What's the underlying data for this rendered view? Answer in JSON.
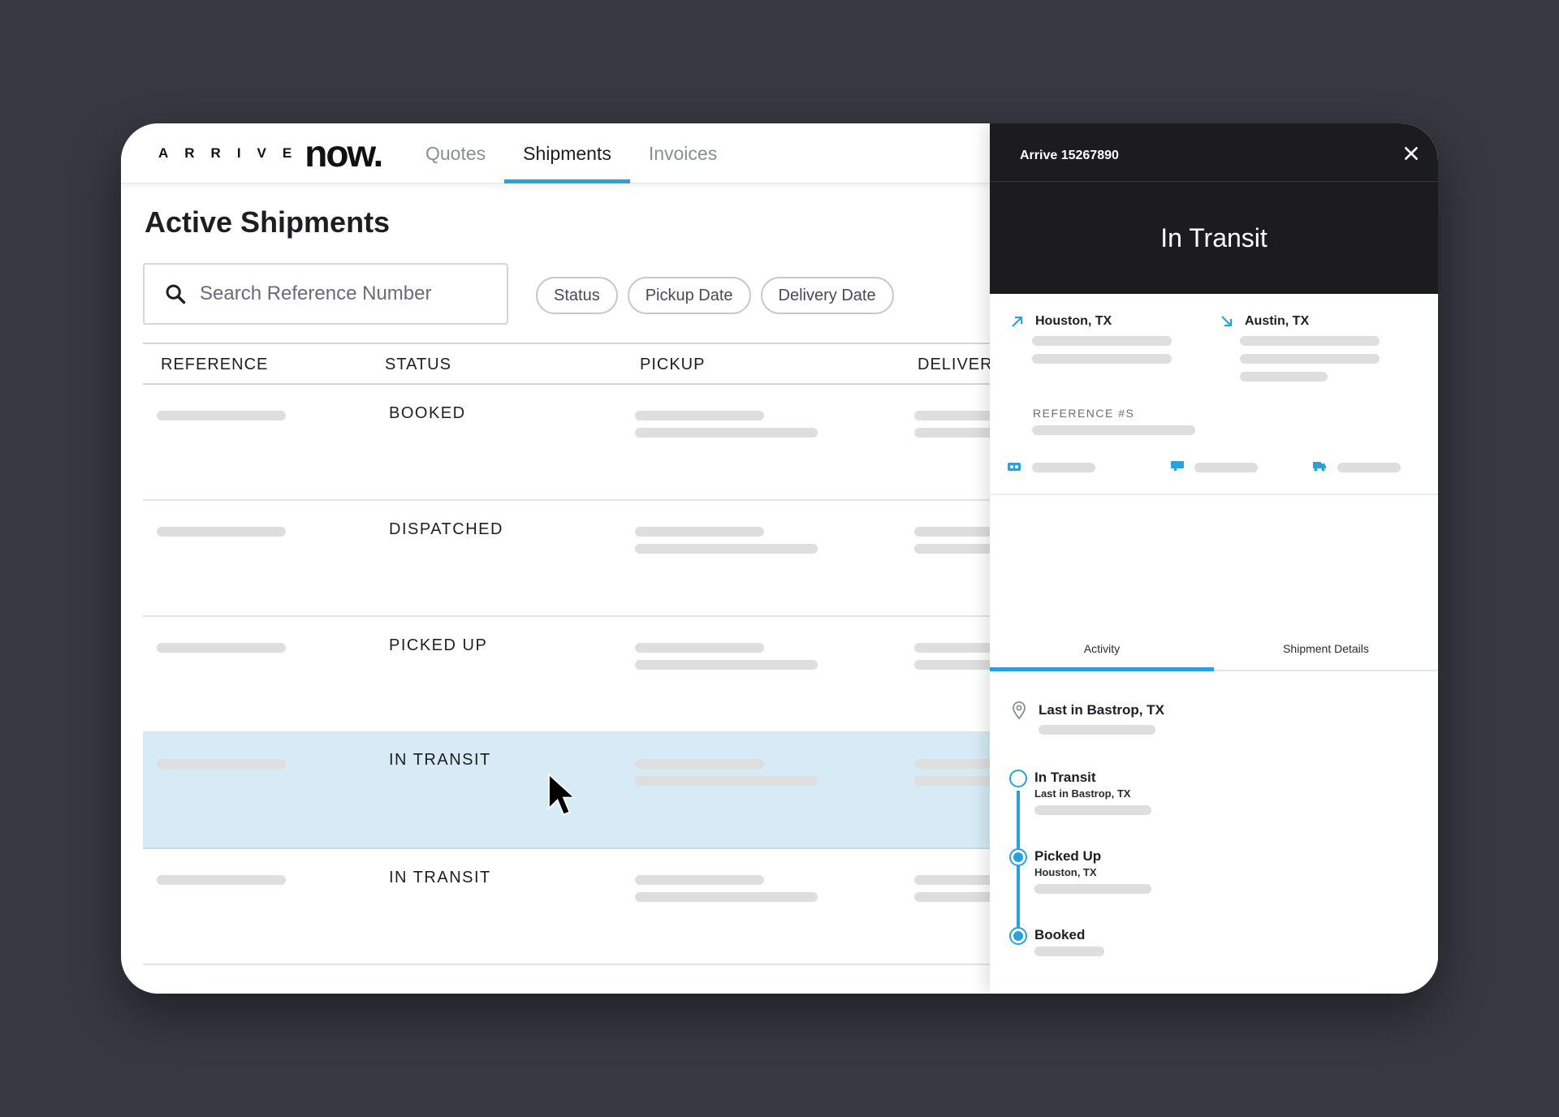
{
  "logo": {
    "arrive": "ARRIVE",
    "now": "now."
  },
  "nav": {
    "tabs": [
      {
        "label": "Quotes"
      },
      {
        "label": "Shipments"
      },
      {
        "label": "Invoices"
      }
    ]
  },
  "page": {
    "title": "Active Shipments"
  },
  "search": {
    "placeholder": "Search Reference Number"
  },
  "filters": {
    "status": "Status",
    "pickup": "Pickup Date",
    "delivery": "Delivery Date"
  },
  "table": {
    "headers": {
      "reference": "REFERENCE",
      "status": "STATUS",
      "pickup": "PICKUP",
      "delivery": "DELIVERY"
    },
    "rows": [
      {
        "status": "BOOKED"
      },
      {
        "status": "DISPATCHED"
      },
      {
        "status": "PICKED UP"
      },
      {
        "status": "IN TRANSIT"
      },
      {
        "status": "IN TRANSIT"
      }
    ]
  },
  "panel": {
    "reference": "Arrive 15267890",
    "status": "In Transit",
    "origin": "Houston, TX",
    "destination": "Austin, TX",
    "reference_label": "REFERENCE #S",
    "tabs": {
      "activity": "Activity",
      "details": "Shipment Details"
    },
    "last_location": "Last in Bastrop, TX",
    "timeline": [
      {
        "title": "In Transit",
        "sub": "Last in Bastrop, TX"
      },
      {
        "title": "Picked Up",
        "sub": "Houston, TX"
      },
      {
        "title": "Booked"
      }
    ]
  },
  "colors": {
    "background": "#383843",
    "accent": "#2aa1da",
    "selected_row": "#d6ebf5",
    "panel_header": "#1c1c1e"
  },
  "icons": [
    "search-icon",
    "close-icon",
    "arrow-up-right-icon",
    "arrow-down-right-icon",
    "ticket-icon",
    "trailer-icon",
    "truck-icon",
    "map-pin-icon",
    "mouse-cursor-icon"
  ]
}
